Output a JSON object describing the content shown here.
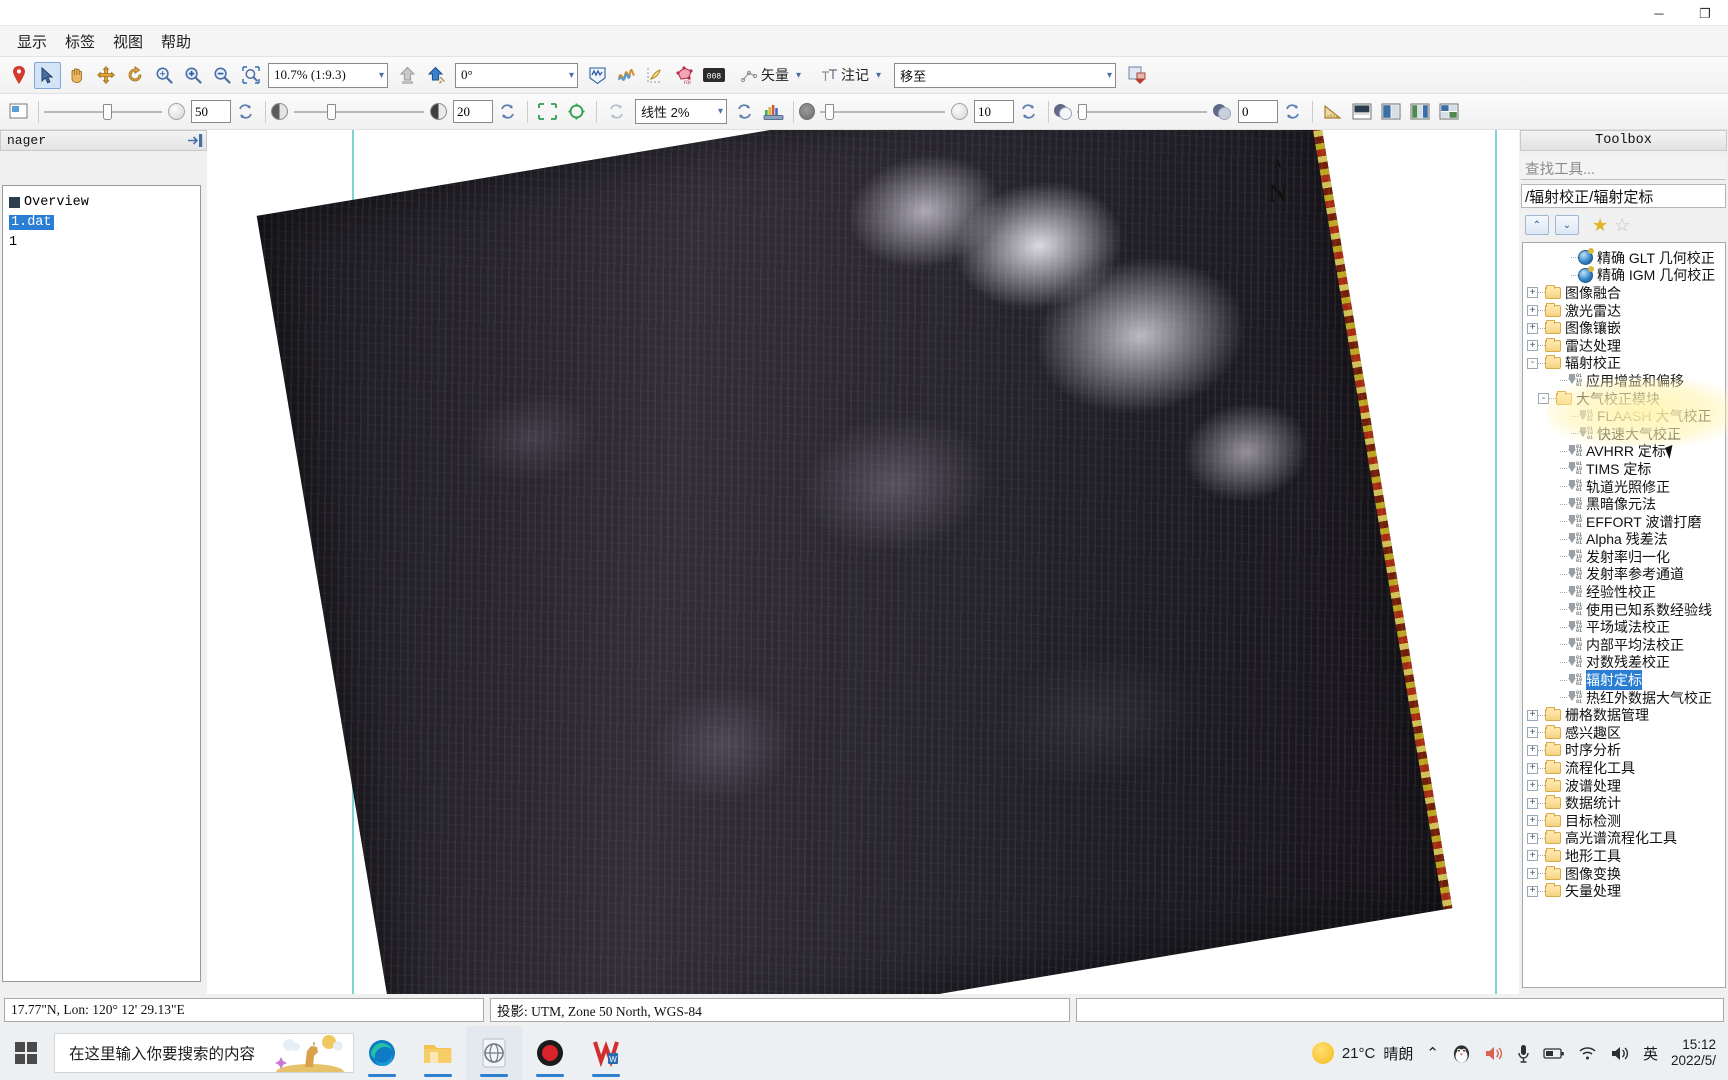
{
  "window": {
    "minimize_label": "─",
    "maximize_label": "❐",
    "close_label": "✕"
  },
  "menubar": {
    "items": [
      {
        "label": "显示",
        "name": "menu-display"
      },
      {
        "label": "标签",
        "name": "menu-labels"
      },
      {
        "label": "视图",
        "name": "menu-view"
      },
      {
        "label": "帮助",
        "name": "menu-help"
      }
    ]
  },
  "toolbar1": {
    "zoom_value": "10.7% (1:9.3)",
    "rotation_value": "0°",
    "vector_label": "矢量",
    "annotation_label": "注记",
    "goto_value": "移至",
    "icons": [
      "pin-icon",
      "select-arrow-icon",
      "pan-hand-icon",
      "move-icon",
      "rotate-icon",
      "zoom-fit-icon",
      "zoom-in-icon",
      "zoom-out-icon",
      "zoom-region-icon"
    ]
  },
  "toolbar2": {
    "transparency_value": "50",
    "brightness_value": "20",
    "stretch_value": "线性 2%",
    "sharpen_value": "10",
    "blend_value": "0"
  },
  "left_panel": {
    "title": "nager",
    "pin_icon": "pin-panel-icon",
    "tree": [
      {
        "label": "Overview",
        "selected": false,
        "name": "layer-overview"
      },
      {
        "label": "1.dat",
        "selected": true,
        "name": "layer-1-dat"
      },
      {
        "label": "1",
        "selected": false,
        "name": "layer-1"
      }
    ]
  },
  "canvas": {
    "north_label": "N",
    "image_name": "satellite-scene"
  },
  "toolbox": {
    "title": "Toolbox",
    "search_placeholder": "查找工具...",
    "path": "/辐射校正/辐射定标",
    "nav_up": "⌃",
    "nav_down": "⌄",
    "star_filled": "★",
    "star_empty": "☆",
    "tree": [
      {
        "label": "精确 GLT 几何校正",
        "indent": 3,
        "icon": "globe",
        "expander": "none",
        "name": "tool-precise-glt"
      },
      {
        "label": "精确 IGM 几何校正",
        "indent": 3,
        "icon": "globe",
        "expander": "none",
        "name": "tool-precise-igm"
      },
      {
        "label": "图像融合",
        "indent": 0,
        "icon": "folder",
        "expander": "+",
        "name": "folder-image-fusion"
      },
      {
        "label": "激光雷达",
        "indent": 0,
        "icon": "folder",
        "expander": "+",
        "name": "folder-lidar"
      },
      {
        "label": "图像镶嵌",
        "indent": 0,
        "icon": "folder",
        "expander": "+",
        "name": "folder-mosaic"
      },
      {
        "label": "雷达处理",
        "indent": 0,
        "icon": "folder",
        "expander": "+",
        "name": "folder-radar"
      },
      {
        "label": "辐射校正",
        "indent": 0,
        "icon": "folder",
        "expander": "-",
        "name": "folder-radiometric-correction"
      },
      {
        "label": "应用增益和偏移",
        "indent": 2,
        "icon": "tool",
        "expander": "none",
        "name": "tool-apply-gain-offset"
      },
      {
        "label": "大气校正模块",
        "indent": 1,
        "icon": "folder",
        "expander": "-",
        "name": "folder-atmospheric-correction"
      },
      {
        "label": "FLAASH 大气校正",
        "indent": 3,
        "icon": "tool",
        "expander": "none",
        "name": "tool-flaash"
      },
      {
        "label": "快速大气校正",
        "indent": 3,
        "icon": "tool",
        "expander": "none",
        "name": "tool-quick-atmospheric"
      },
      {
        "label": "AVHRR 定标",
        "indent": 2,
        "icon": "tool",
        "expander": "none",
        "name": "tool-avhrr-calibration"
      },
      {
        "label": "TIMS 定标",
        "indent": 2,
        "icon": "tool",
        "expander": "none",
        "name": "tool-tims-calibration"
      },
      {
        "label": "轨道光照修正",
        "indent": 2,
        "icon": "tool",
        "expander": "none",
        "name": "tool-orbital-illumination"
      },
      {
        "label": "黑暗像元法",
        "indent": 2,
        "icon": "tool",
        "expander": "none",
        "name": "tool-dark-subtract"
      },
      {
        "label": "EFFORT 波谱打磨",
        "indent": 2,
        "icon": "tool",
        "expander": "none",
        "name": "tool-effort-polishing"
      },
      {
        "label": "Alpha 残差法",
        "indent": 2,
        "icon": "tool",
        "expander": "none",
        "name": "tool-alpha-residuals"
      },
      {
        "label": "发射率归一化",
        "indent": 2,
        "icon": "tool",
        "expander": "none",
        "name": "tool-emissivity-normalization"
      },
      {
        "label": "发射率参考通道",
        "indent": 2,
        "icon": "tool",
        "expander": "none",
        "name": "tool-reference-channel-emissivity"
      },
      {
        "label": "经验性校正",
        "indent": 2,
        "icon": "tool",
        "expander": "none",
        "name": "tool-empirical-line"
      },
      {
        "label": "使用已知系数经验线",
        "indent": 2,
        "icon": "tool",
        "expander": "none",
        "name": "tool-empirical-known-coeff"
      },
      {
        "label": "平场域法校正",
        "indent": 2,
        "icon": "tool",
        "expander": "none",
        "name": "tool-flat-field"
      },
      {
        "label": "内部平均法校正",
        "indent": 2,
        "icon": "tool",
        "expander": "none",
        "name": "tool-internal-average"
      },
      {
        "label": "对数残差校正",
        "indent": 2,
        "icon": "tool",
        "expander": "none",
        "name": "tool-log-residuals"
      },
      {
        "label": "辐射定标",
        "indent": 2,
        "icon": "tool",
        "expander": "none",
        "highlight": true,
        "name": "tool-radiometric-calibration"
      },
      {
        "label": "热红外数据大气校正",
        "indent": 2,
        "icon": "tool",
        "expander": "none",
        "name": "tool-thermal-ir-atmospheric"
      },
      {
        "label": "栅格数据管理",
        "indent": 0,
        "icon": "folder",
        "expander": "+",
        "name": "folder-raster-management"
      },
      {
        "label": "感兴趣区",
        "indent": 0,
        "icon": "folder",
        "expander": "+",
        "name": "folder-roi"
      },
      {
        "label": "时序分析",
        "indent": 0,
        "icon": "folder",
        "expander": "+",
        "name": "folder-time-series"
      },
      {
        "label": "流程化工具",
        "indent": 0,
        "icon": "folder",
        "expander": "+",
        "name": "folder-workflow-tools"
      },
      {
        "label": "波谱处理",
        "indent": 0,
        "icon": "folder",
        "expander": "+",
        "name": "folder-spectral-processing"
      },
      {
        "label": "数据统计",
        "indent": 0,
        "icon": "folder",
        "expander": "+",
        "name": "folder-statistics"
      },
      {
        "label": "目标检测",
        "indent": 0,
        "icon": "folder",
        "expander": "+",
        "name": "folder-target-detection"
      },
      {
        "label": "高光谱流程化工具",
        "indent": 0,
        "icon": "folder",
        "expander": "+",
        "name": "folder-hyperspectral-workflow"
      },
      {
        "label": "地形工具",
        "indent": 0,
        "icon": "folder",
        "expander": "+",
        "name": "folder-terrain-tools"
      },
      {
        "label": "图像变换",
        "indent": 0,
        "icon": "folder",
        "expander": "+",
        "name": "folder-image-transform"
      },
      {
        "label": "矢量处理",
        "indent": 0,
        "icon": "folder",
        "expander": "+",
        "name": "folder-vector-processing"
      }
    ]
  },
  "statusbar": {
    "coordinates": "17.77\"N, Lon: 120° 12' 29.13\"E",
    "projection": "投影: UTM, Zone 50 North, WGS-84"
  },
  "taskbar": {
    "search_placeholder": "在这里输入你要搜索的内容",
    "apps": [
      {
        "name": "taskbar-edge",
        "icon": "edge-icon"
      },
      {
        "name": "taskbar-file-explorer",
        "icon": "folder-icon"
      },
      {
        "name": "taskbar-envi",
        "icon": "envi-icon",
        "active": true
      },
      {
        "name": "taskbar-recorder",
        "icon": "record-icon"
      },
      {
        "name": "taskbar-wps",
        "icon": "wps-icon"
      }
    ],
    "weather_temp": "21°C",
    "weather_desc": "晴朗",
    "tray_chevron": "⌃",
    "tray_icons": [
      "qq-icon",
      "volume-icon",
      "microphone-icon",
      "battery-icon",
      "wifi-icon",
      "speaker-icon"
    ],
    "ime": "英",
    "time": "15:12",
    "date": "2022/5/"
  },
  "colors": {
    "accent": "#2a7fd4",
    "highlight": "#d4e4f7",
    "toolbar_bg": "#f1f1f1",
    "panel_bg": "#f0f0f0"
  }
}
